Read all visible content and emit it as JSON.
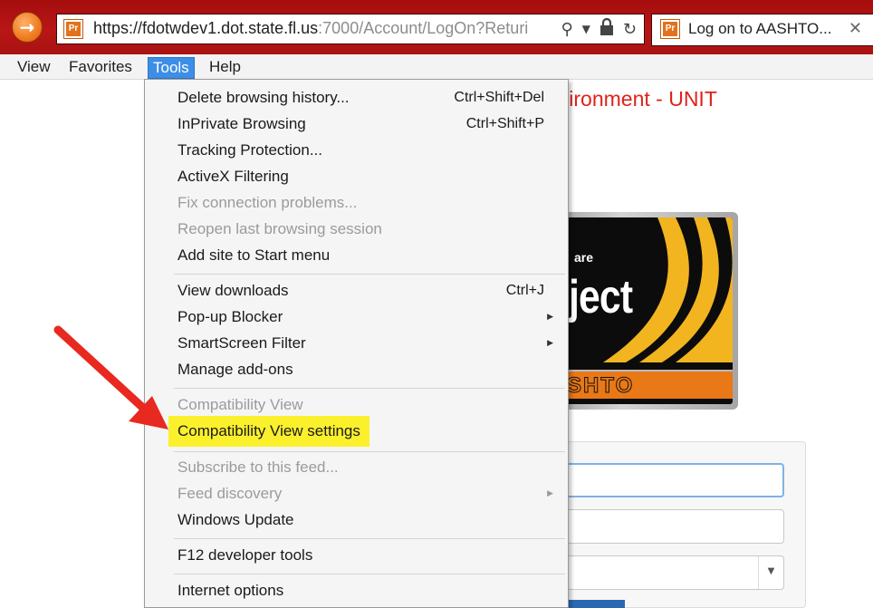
{
  "browser": {
    "url_main": "https://fdotwdev1.dot.state.fl.us",
    "url_rest": ":7000/Account/LogOn?Returi",
    "tab_title": "Log on to AASHTO...",
    "favicon_text": "Pr",
    "icons": {
      "back": "back-arrow-icon",
      "search": "search-icon",
      "dropdown": "dropdown-arrow-icon",
      "lock": "lock-icon",
      "refresh": "refresh-icon",
      "close": "close-icon"
    }
  },
  "menubar": {
    "items": [
      {
        "label": "View"
      },
      {
        "label": "Favorites"
      },
      {
        "label": "Tools"
      },
      {
        "label": "Help"
      }
    ],
    "active": "Tools"
  },
  "page": {
    "heading": "nvironment - UNIT",
    "logo": {
      "small_text": "are",
      "big_text": "ject",
      "band_text": "SHTO"
    }
  },
  "tools_menu": {
    "items": [
      {
        "label": "Delete browsing history...",
        "shortcut": "Ctrl+Shift+Del",
        "enabled": true
      },
      {
        "label": "InPrivate Browsing",
        "shortcut": "Ctrl+Shift+P",
        "enabled": true
      },
      {
        "label": "Tracking Protection...",
        "enabled": true
      },
      {
        "label": "ActiveX Filtering",
        "enabled": true
      },
      {
        "label": "Fix connection problems...",
        "enabled": false
      },
      {
        "label": "Reopen last browsing session",
        "enabled": false
      },
      {
        "label": "Add site to Start menu",
        "enabled": true
      },
      {
        "label": "View downloads",
        "shortcut": "Ctrl+J",
        "enabled": true
      },
      {
        "label": "Pop-up Blocker",
        "submenu": true,
        "enabled": true
      },
      {
        "label": "SmartScreen Filter",
        "submenu": true,
        "enabled": true
      },
      {
        "label": "Manage add-ons",
        "enabled": true
      },
      {
        "label": "Compatibility View",
        "enabled": false
      },
      {
        "label": "Compatibility View settings",
        "enabled": true,
        "highlighted": true
      },
      {
        "label": "Subscribe to this feed...",
        "enabled": false
      },
      {
        "label": "Feed discovery",
        "submenu": true,
        "enabled": false
      },
      {
        "label": "Windows Update",
        "enabled": true
      },
      {
        "label": "F12 developer tools",
        "enabled": true
      },
      {
        "label": "Internet options",
        "enabled": true
      }
    ]
  },
  "annotation": {
    "arrow_color": "#e8291f",
    "highlight_color": "#fbf02c"
  },
  "colors": {
    "titlebar": "#b01313",
    "menu_active": "#3d8ee6",
    "heading_red": "#e0221a"
  }
}
